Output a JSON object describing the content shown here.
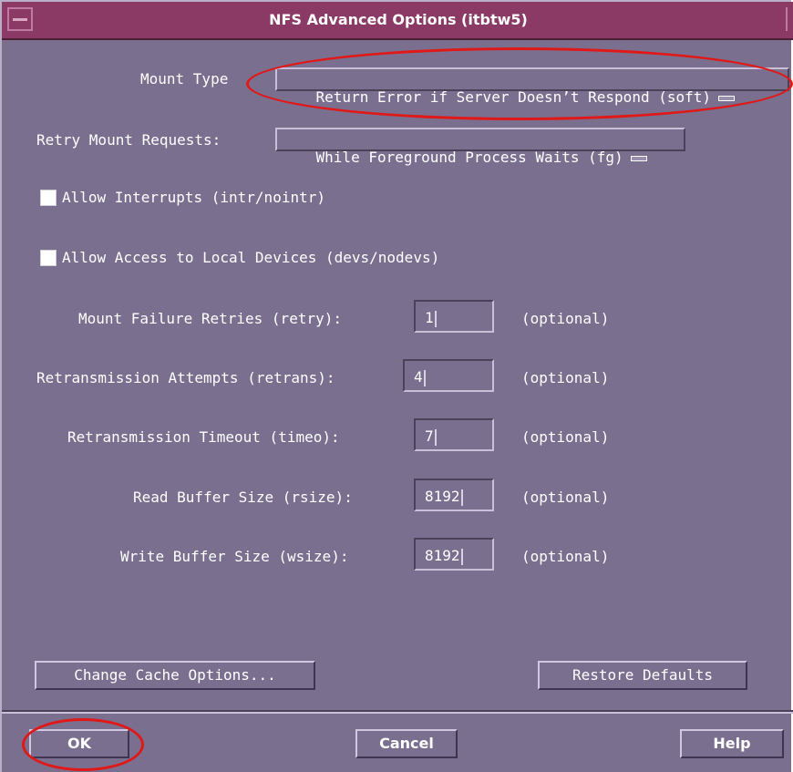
{
  "window": {
    "title": "NFS Advanced Options (itbtw5)"
  },
  "mount_type": {
    "label": "Mount Type",
    "value": "Return Error if Server Doesn’t Respond (soft)"
  },
  "retry_mount": {
    "label": "Retry Mount Requests:",
    "value": "While Foreground Process Waits (fg)"
  },
  "checkboxes": {
    "interrupts": {
      "label": "Allow Interrupts (intr/nointr)",
      "checked": false
    },
    "local_devices": {
      "label": "Allow Access to Local Devices (devs/nodevs)",
      "checked": false
    }
  },
  "fields": [
    {
      "label": "Mount Failure Retries (retry):",
      "value": "1",
      "hint": "(optional)"
    },
    {
      "label": "Retransmission Attempts (retrans):",
      "value": "4",
      "hint": "(optional)"
    },
    {
      "label": "Retransmission Timeout (timeo):",
      "value": "7",
      "hint": "(optional)"
    },
    {
      "label": "Read Buffer Size (rsize):",
      "value": "8192",
      "hint": "(optional)"
    },
    {
      "label": "Write Buffer Size (wsize):",
      "value": "8192",
      "hint": "(optional)"
    }
  ],
  "buttons": {
    "change_cache": "Change Cache Options...",
    "restore_defaults": "Restore Defaults",
    "ok": "OK",
    "cancel": "Cancel",
    "help": "Help"
  },
  "colors": {
    "background": "#7a6f8f",
    "titlebar": "#8a3a64",
    "annotation": "#e01818"
  },
  "icons": {
    "system_menu": "window-menu-icon",
    "option_indicator": "option-menu-indicator-icon"
  }
}
